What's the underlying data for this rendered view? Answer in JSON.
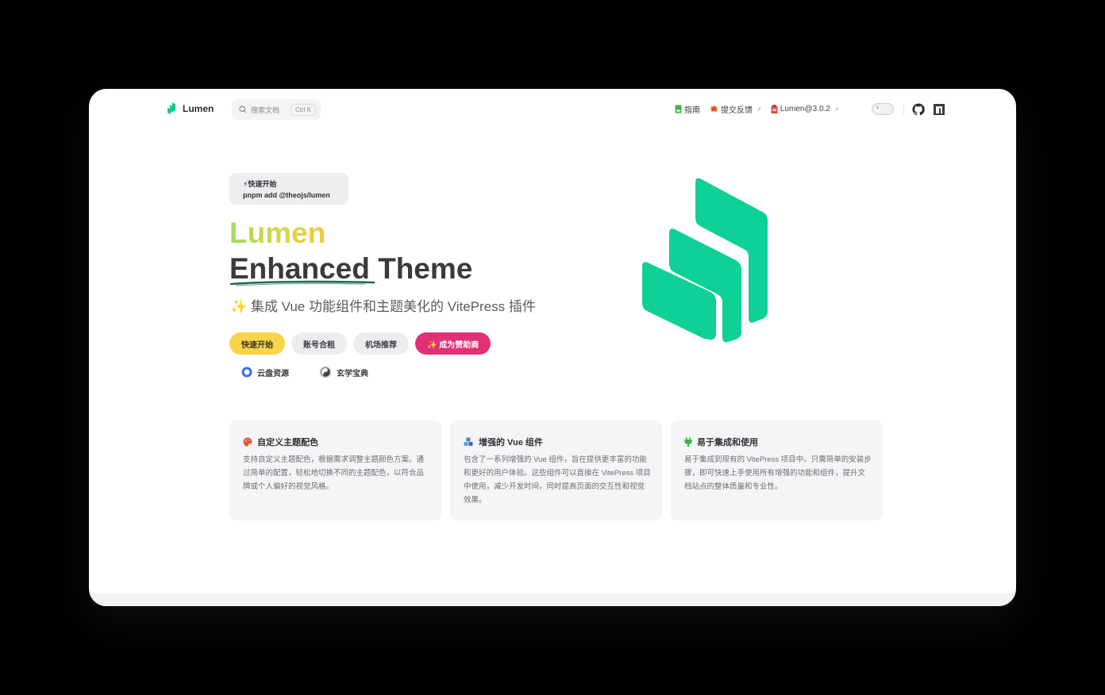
{
  "nav": {
    "brand": "Lumen",
    "search_placeholder": "搜索文档",
    "search_shortcut": "Ctrl K",
    "links": [
      {
        "label": "指南",
        "icon": "book-icon",
        "external": false
      },
      {
        "label": "提交反馈",
        "icon": "maple-leaf-icon",
        "external": true
      },
      {
        "label": "Lumen@3.0.2",
        "icon": "clipboard-icon",
        "external": true
      }
    ],
    "external_mark": "↗"
  },
  "hero": {
    "quick_title": "⚡快速开始",
    "quick_command": "pnpm add @theojs/lumen",
    "name": "Lumen",
    "text": "Enhanced Theme",
    "tagline": "✨ 集成 Vue 功能组件和主题美化的 VitePress 插件",
    "actions": [
      {
        "label": "快速开始",
        "style": "brand"
      },
      {
        "label": "账号合租",
        "style": "alt"
      },
      {
        "label": "机场推荐",
        "style": "alt"
      },
      {
        "label": "✨ 成为赞助商",
        "style": "sponsor"
      }
    ],
    "sub_links": [
      {
        "label": "云盘资源",
        "icon": "ring-icon"
      },
      {
        "label": "玄学宝典",
        "icon": "yin-yang-icon"
      }
    ]
  },
  "features": [
    {
      "icon": "palette-icon",
      "title": "自定义主题配色",
      "desc": "支持自定义主题配色，根据需求调整主题颜色方案。通过简单的配置，轻松地切换不同的主题配色，以符合品牌或个人偏好的视觉风格。"
    },
    {
      "icon": "cubes-icon",
      "title": "增强的 Vue 组件",
      "desc": "包含了一系列增强的 Vue 组件，旨在提供更丰富的功能和更好的用户体验。这些组件可以直接在 VitePress 项目中使用，减少开发时间，同时提高页面的交互性和视觉效果。"
    },
    {
      "icon": "plug-icon",
      "title": "易于集成和使用",
      "desc": "易于集成到现有的 VitePress 项目中。只需简单的安装步骤，即可快速上手使用所有增强的功能和组件，提升文档站点的整体质量和专业性。"
    }
  ],
  "colors": {
    "brand_green": "#10c98a",
    "brand_yellow": "#f7d449",
    "sponsor_pink": "#e03176"
  }
}
